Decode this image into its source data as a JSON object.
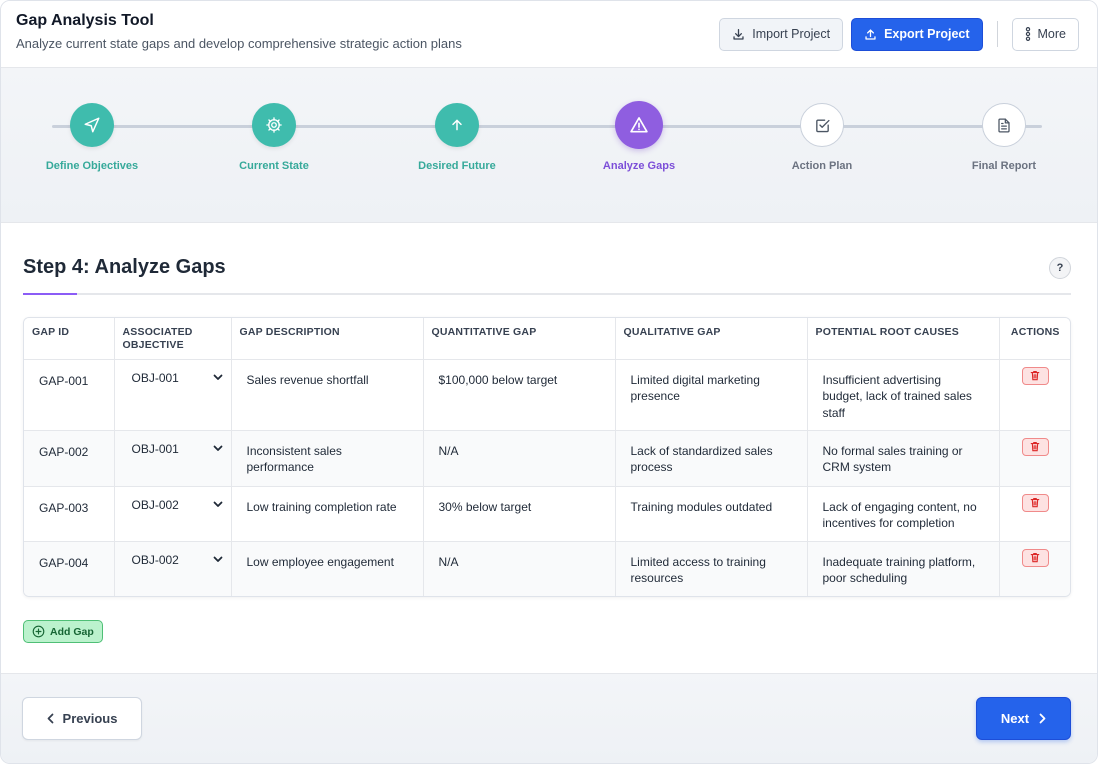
{
  "header": {
    "title": "Gap Analysis Tool",
    "subtitle": "Analyze current state gaps and develop comprehensive strategic action plans",
    "import_label": "Import Project",
    "export_label": "Export Project",
    "more_label": "More"
  },
  "steps": [
    {
      "label": "Define Objectives",
      "status": "done",
      "icon": "navigation-icon"
    },
    {
      "label": "Current State",
      "status": "done",
      "icon": "gear-icon"
    },
    {
      "label": "Desired Future",
      "status": "done",
      "icon": "arrow-up-icon"
    },
    {
      "label": "Analyze Gaps",
      "status": "active",
      "icon": "warning-triangle-icon"
    },
    {
      "label": "Action Plan",
      "status": "todo",
      "icon": "checkbox-icon"
    },
    {
      "label": "Final Report",
      "status": "todo",
      "icon": "document-icon"
    }
  ],
  "main": {
    "step_title": "Step 4: Analyze Gaps",
    "help_label": "?",
    "add_gap_label": "Add Gap"
  },
  "table": {
    "headers": {
      "gap_id": "GAP ID",
      "objective": "ASSOCIATED OBJECTIVE",
      "description": "GAP DESCRIPTION",
      "quantitative": "QUANTITATIVE GAP",
      "qualitative": "QUALITATIVE GAP",
      "root_causes": "POTENTIAL ROOT CAUSES",
      "actions": "ACTIONS"
    },
    "rows": [
      {
        "id": "GAP-001",
        "objective": "OBJ-001",
        "description": "Sales revenue shortfall",
        "quantitative": "$100,000 below target",
        "qualitative": "Limited digital marketing presence",
        "root_causes": "Insufficient advertising budget, lack of trained sales staff"
      },
      {
        "id": "GAP-002",
        "objective": "OBJ-001",
        "description": "Inconsistent sales performance",
        "quantitative": "N/A",
        "qualitative": "Lack of standardized sales process",
        "root_causes": "No formal sales training or CRM system"
      },
      {
        "id": "GAP-003",
        "objective": "OBJ-002",
        "description": "Low training completion rate",
        "quantitative": "30% below target",
        "qualitative": "Training modules outdated",
        "root_causes": "Lack of engaging content, no incentives for completion"
      },
      {
        "id": "GAP-004",
        "objective": "OBJ-002",
        "description": "Low employee engagement",
        "quantitative": "N/A",
        "qualitative": "Limited access to training resources",
        "root_causes": "Inadequate training platform, poor scheduling"
      }
    ]
  },
  "footer": {
    "previous_label": "Previous",
    "next_label": "Next"
  },
  "colors": {
    "primary": "#2563eb",
    "done": "#3fbcad",
    "active": "#8f5ee0",
    "danger": "#f08a8a",
    "success": "#4fbf76"
  }
}
